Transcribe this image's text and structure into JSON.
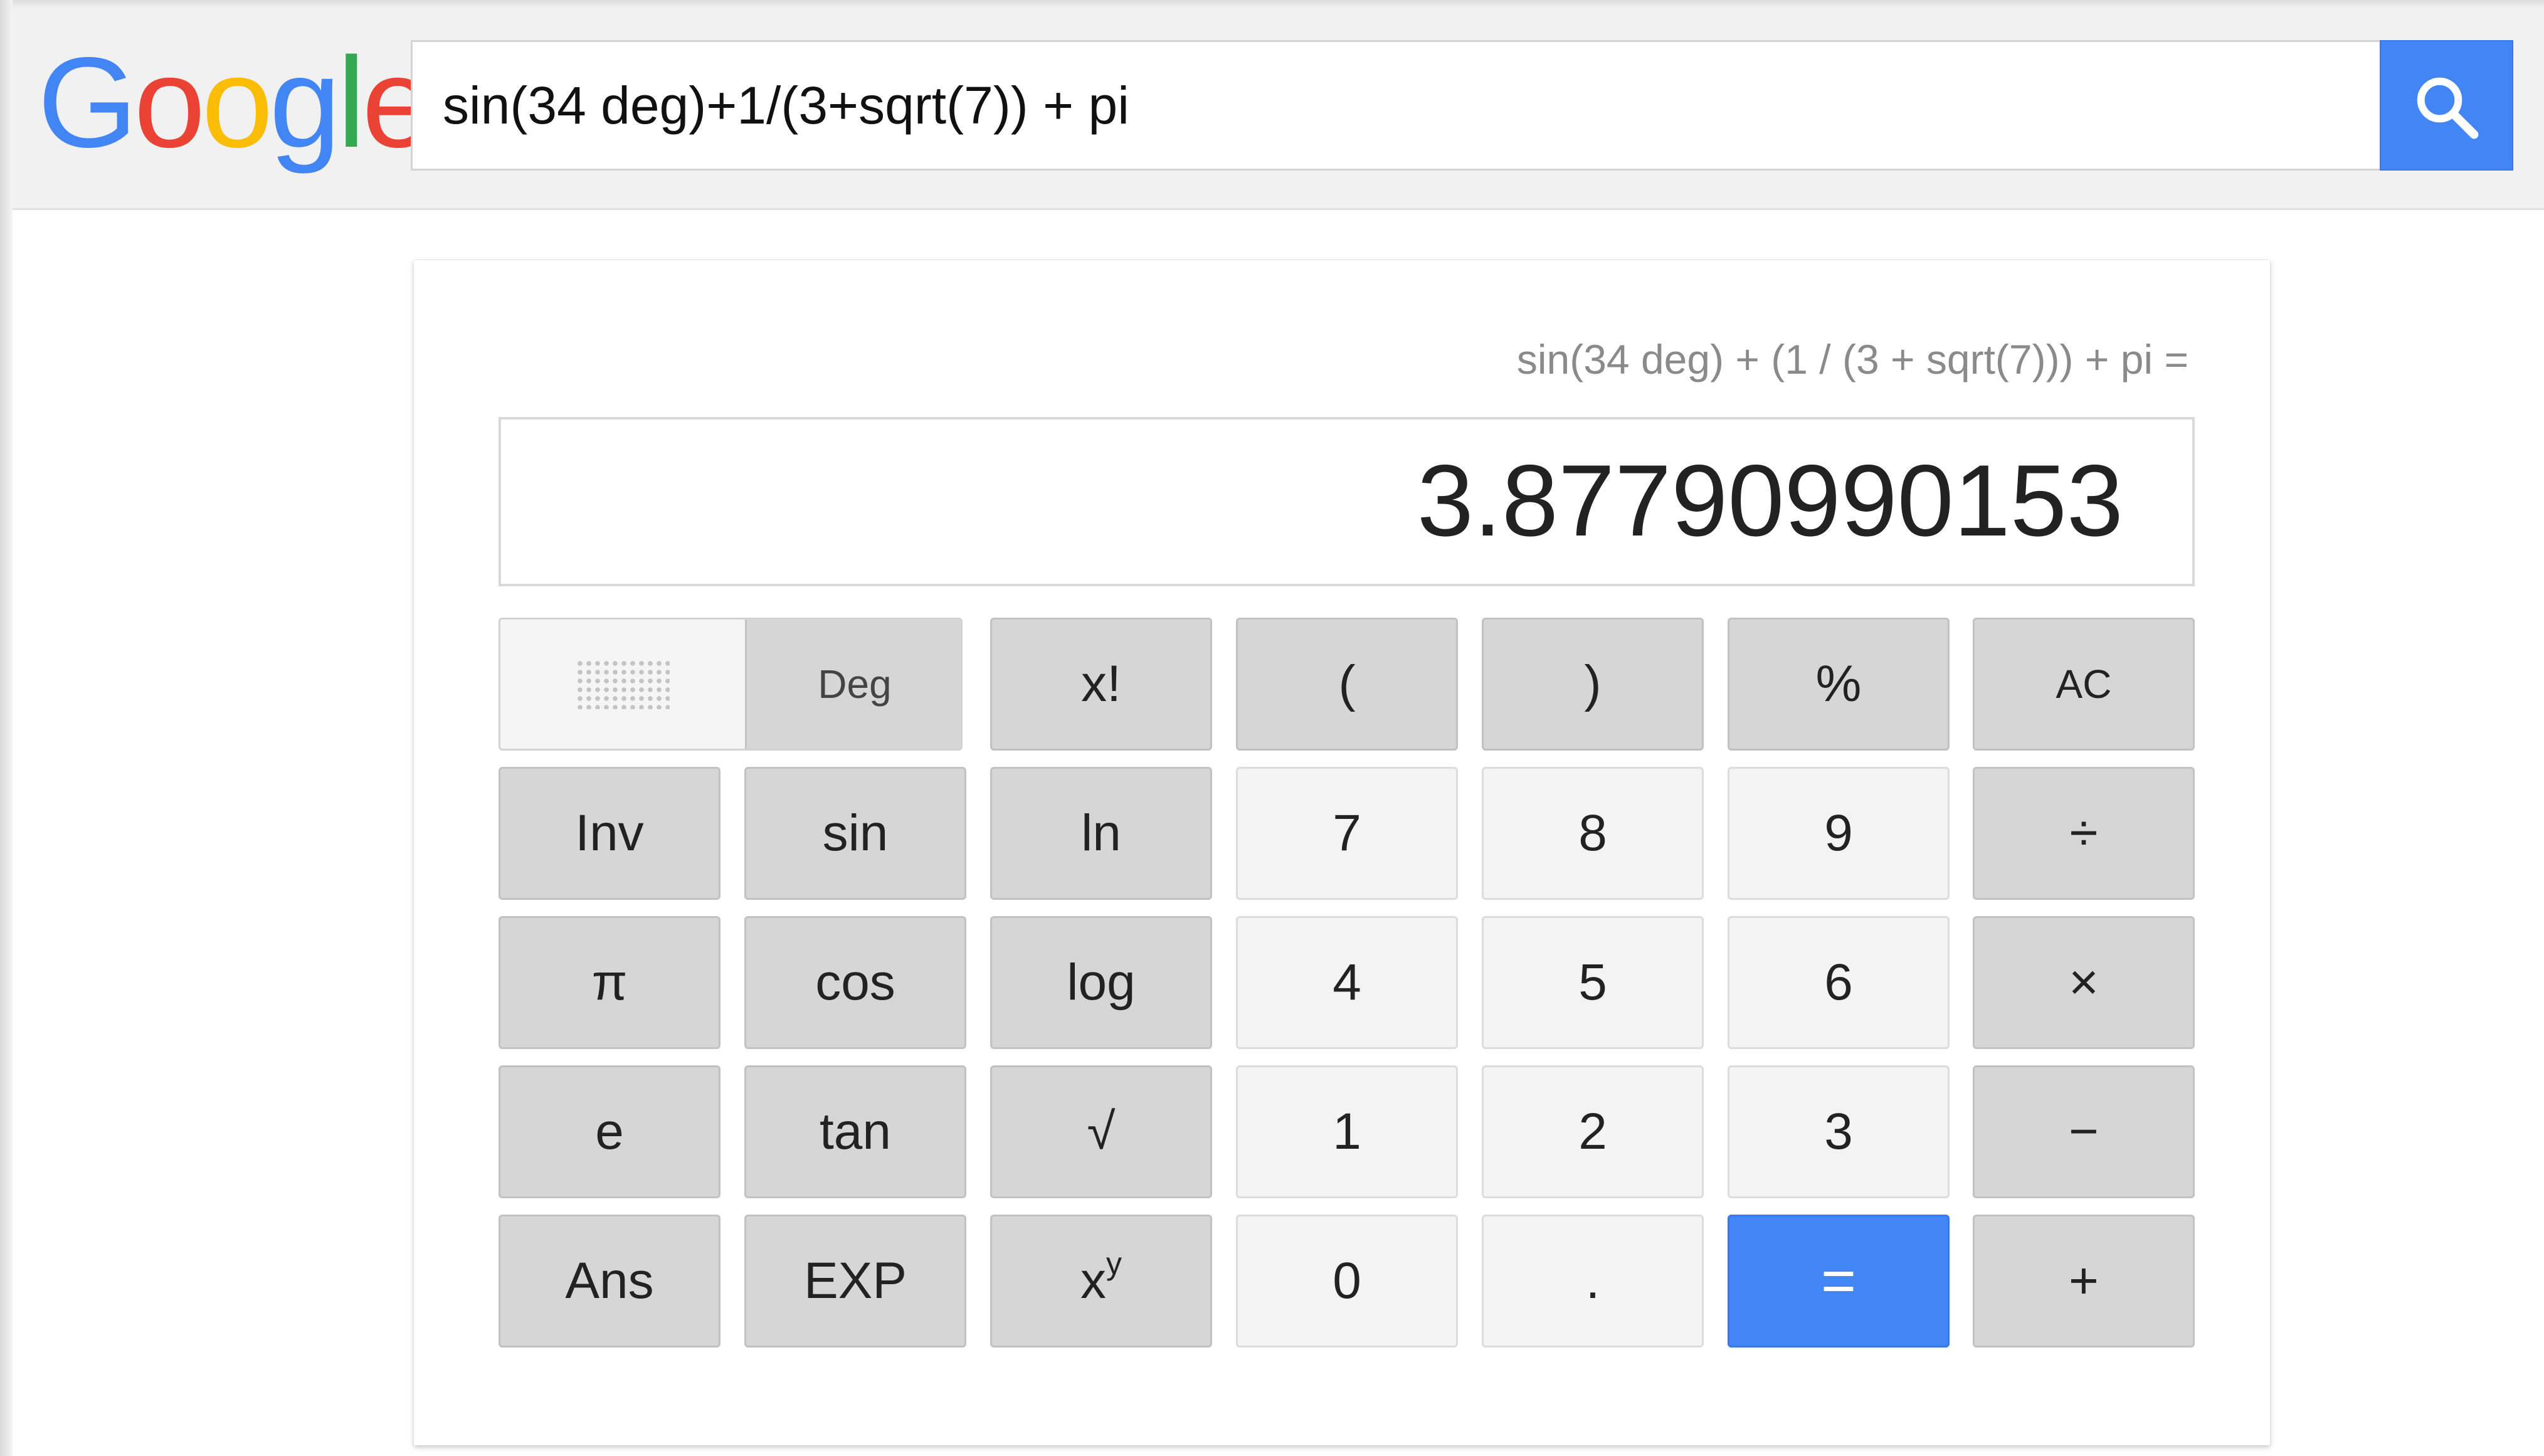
{
  "header": {
    "logo_letters": [
      {
        "char": "G",
        "color": "#4285f4"
      },
      {
        "char": "o",
        "color": "#ea4335"
      },
      {
        "char": "o",
        "color": "#fbbc05"
      },
      {
        "char": "g",
        "color": "#4285f4"
      },
      {
        "char": "l",
        "color": "#34a853"
      },
      {
        "char": "e",
        "color": "#ea4335"
      }
    ],
    "search_value": "sin(34 deg)+1/(3+sqrt(7)) + pi",
    "search_button_icon": "search-icon",
    "search_button_color": "#4285f4"
  },
  "calculator": {
    "expression": "sin(34 deg) + (1 / (3 + sqrt(7))) + pi =",
    "result": "3.87790990153",
    "angle_mode": "Deg",
    "rows": [
      [
        "x!",
        "(",
        ")",
        "%",
        "AC"
      ],
      [
        "Inv",
        "sin",
        "ln",
        "7",
        "8",
        "9",
        "÷"
      ],
      [
        "π",
        "cos",
        "log",
        "4",
        "5",
        "6",
        "×"
      ],
      [
        "e",
        "tan",
        "√",
        "1",
        "2",
        "3",
        "−"
      ],
      [
        "Ans",
        "EXP",
        "x^y",
        "0",
        ".",
        "=",
        "+"
      ]
    ],
    "exp_base": "x",
    "exp_power": "y",
    "equals_color": "#4285f4"
  }
}
